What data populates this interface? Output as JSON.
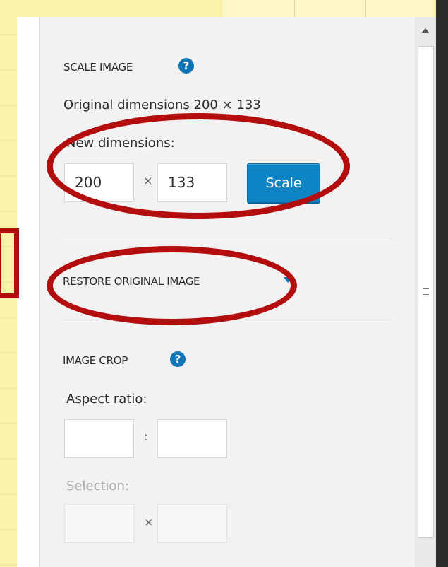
{
  "scale": {
    "title": "SCALE IMAGE",
    "help": "?",
    "original_dimensions": "Original dimensions 200 × 133",
    "new_dimensions_label": "New dimensions:",
    "width_value": "200",
    "times": "×",
    "height_value": "133",
    "scale_button": "Scale"
  },
  "restore": {
    "title": "RESTORE ORIGINAL IMAGE"
  },
  "crop": {
    "title": "IMAGE CROP",
    "help": "?",
    "aspect_label": "Aspect ratio:",
    "aspect_colon": ":",
    "aspect_w": "",
    "aspect_h": "",
    "selection_label": "Selection:",
    "selection_times": "×",
    "selection_w": "",
    "selection_h": ""
  },
  "colors": {
    "accent": "#0f84c4",
    "annotation": "#b30d0d"
  }
}
